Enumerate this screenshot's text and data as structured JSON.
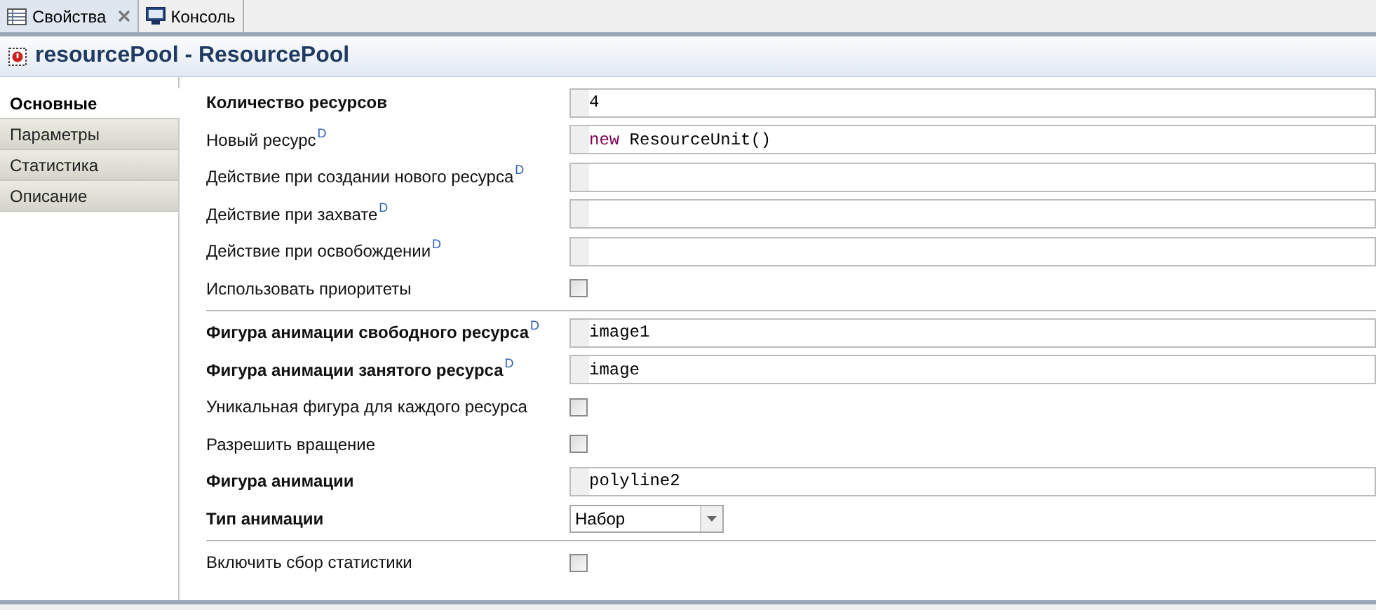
{
  "view_tabs": [
    {
      "label": "Свойства",
      "selected": true,
      "closable": true
    },
    {
      "label": "Консоль",
      "selected": false,
      "closable": false
    }
  ],
  "header": {
    "title": "resourcePool - ResourcePool"
  },
  "sidebar": {
    "items": [
      {
        "label": "Основные",
        "selected": true
      },
      {
        "label": "Параметры",
        "selected": false
      },
      {
        "label": "Статистика",
        "selected": false
      },
      {
        "label": "Описание",
        "selected": false
      }
    ]
  },
  "sections": [
    {
      "rows": [
        {
          "kind": "field",
          "label": "Количество ресурсов",
          "bold": true,
          "value": [
            {
              "text": "4",
              "kind": "plain"
            }
          ]
        },
        {
          "kind": "field",
          "label": "Новый ресурс",
          "bold": false,
          "marker": "D",
          "value": [
            {
              "text": "new",
              "kind": "keyword"
            },
            {
              "text": " ResourceUnit()",
              "kind": "plain"
            }
          ]
        },
        {
          "kind": "field",
          "label": "Действие при создании нового ресурса",
          "bold": false,
          "marker": "D",
          "value": []
        },
        {
          "kind": "field",
          "label": "Действие при захвате",
          "bold": false,
          "marker": "D",
          "value": []
        },
        {
          "kind": "field",
          "label": "Действие при освобождении",
          "bold": false,
          "marker": "D",
          "value": []
        },
        {
          "kind": "check",
          "label": "Использовать приоритеты",
          "bold": false,
          "checked": false
        }
      ]
    },
    {
      "rows": [
        {
          "kind": "field",
          "label": "Фигура анимации свободного ресурса",
          "bold": true,
          "marker": "D",
          "value": [
            {
              "text": "image1",
              "kind": "plain"
            }
          ]
        },
        {
          "kind": "field",
          "label": "Фигура анимации занятого ресурса",
          "bold": true,
          "marker": "D",
          "value": [
            {
              "text": "image",
              "kind": "plain"
            }
          ]
        },
        {
          "kind": "check",
          "label": "Уникальная фигура для каждого ресурса",
          "bold": false,
          "checked": false
        },
        {
          "kind": "check",
          "label": "Разрешить вращение",
          "bold": false,
          "checked": false
        },
        {
          "kind": "field",
          "label": "Фигура анимации",
          "bold": true,
          "value": [
            {
              "text": "polyline2",
              "kind": "plain"
            }
          ]
        },
        {
          "kind": "select",
          "label": "Тип анимации",
          "bold": true,
          "value_text": "Набор"
        }
      ]
    },
    {
      "rows": [
        {
          "kind": "check",
          "label": "Включить сбор статистики",
          "bold": false,
          "checked": false
        }
      ]
    }
  ]
}
